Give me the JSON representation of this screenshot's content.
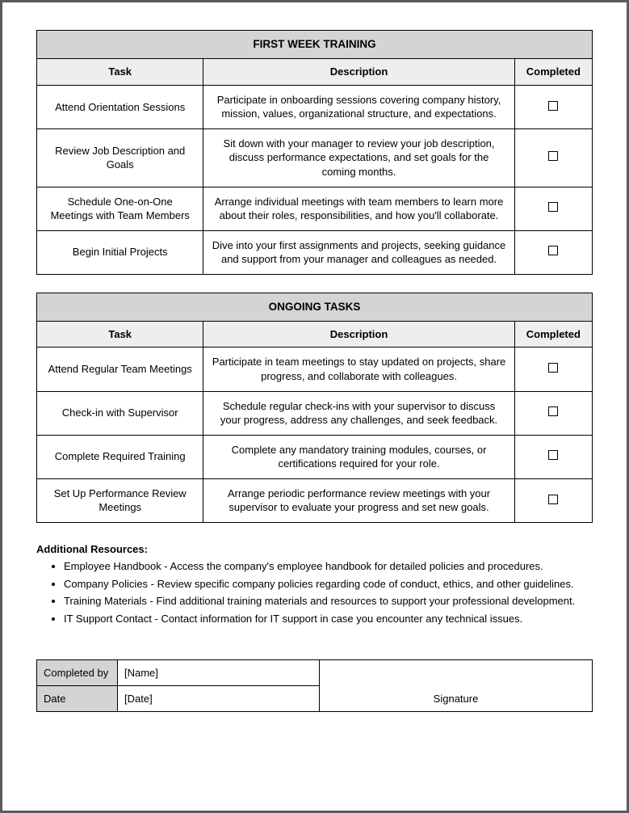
{
  "tables": [
    {
      "title": "FIRST WEEK TRAINING",
      "columns": [
        "Task",
        "Description",
        "Completed"
      ],
      "rows": [
        {
          "task": "Attend Orientation Sessions",
          "desc": "Participate in onboarding sessions covering company history, mission, values, organizational structure, and expectations."
        },
        {
          "task": "Review Job Description and Goals",
          "desc": "Sit down with your manager to review your job description, discuss performance expectations, and set goals for the coming months."
        },
        {
          "task": "Schedule One-on-One Meetings with Team Members",
          "desc": "Arrange individual meetings with team members to learn more about their roles, responsibilities, and how you'll collaborate."
        },
        {
          "task": "Begin Initial Projects",
          "desc": "Dive into your first assignments and projects, seeking guidance and support from your manager and colleagues as needed."
        }
      ]
    },
    {
      "title": "ONGOING TASKS",
      "columns": [
        "Task",
        "Description",
        "Completed"
      ],
      "rows": [
        {
          "task": "Attend Regular Team Meetings",
          "desc": "Participate in team meetings to stay updated on projects, share progress, and collaborate with colleagues."
        },
        {
          "task": "Check-in with Supervisor",
          "desc": "Schedule regular check-ins with your supervisor to discuss your progress, address any challenges, and seek feedback."
        },
        {
          "task": "Complete Required Training",
          "desc": "Complete any mandatory training modules, courses, or certifications required for your role."
        },
        {
          "task": "Set Up Performance Review Meetings",
          "desc": "Arrange periodic performance review meetings with your supervisor to evaluate your progress and set new goals."
        }
      ]
    }
  ],
  "resources": {
    "title": "Additional Resources:",
    "items": [
      "Employee Handbook - Access the company's employee handbook for detailed policies and procedures.",
      "Company Policies - Review specific company policies regarding code of conduct, ethics, and other guidelines.",
      "Training Materials - Find additional training materials and resources to support your professional development.",
      "IT Support Contact - Contact information for IT support in case you encounter any technical issues."
    ]
  },
  "signoff": {
    "completed_by_label": "Completed by",
    "completed_by_value": "[Name]",
    "date_label": "Date",
    "date_value": "[Date]",
    "signature_label": "Signature"
  }
}
